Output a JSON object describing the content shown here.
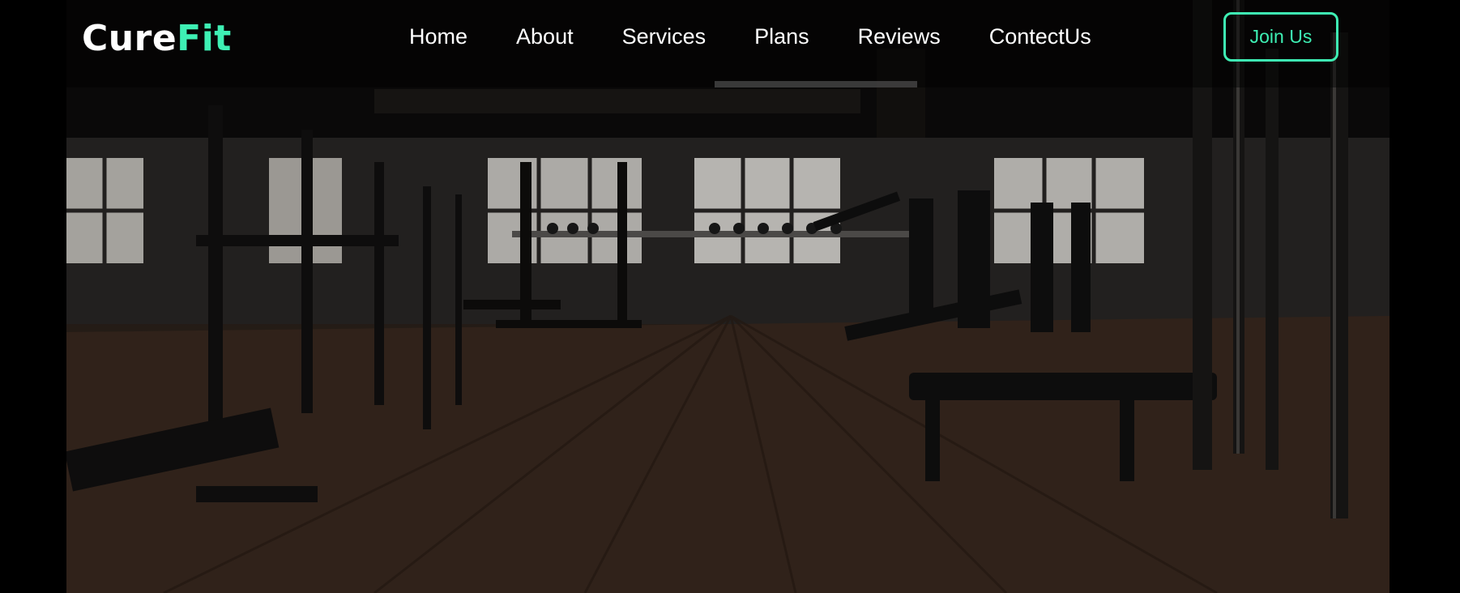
{
  "brand": {
    "part1": "Cure",
    "part2": "Fit"
  },
  "nav": {
    "items": [
      {
        "label": "Home"
      },
      {
        "label": "About"
      },
      {
        "label": "Services"
      },
      {
        "label": "Plans"
      },
      {
        "label": "Reviews"
      },
      {
        "label": "ContectUs"
      }
    ],
    "cta": "Join Us"
  },
  "colors": {
    "accent": "#3ef0b4",
    "background": "#000000",
    "text": "#ffffff"
  },
  "hero": {
    "image": "dark gym interior with benches, racks and wooden floor"
  }
}
